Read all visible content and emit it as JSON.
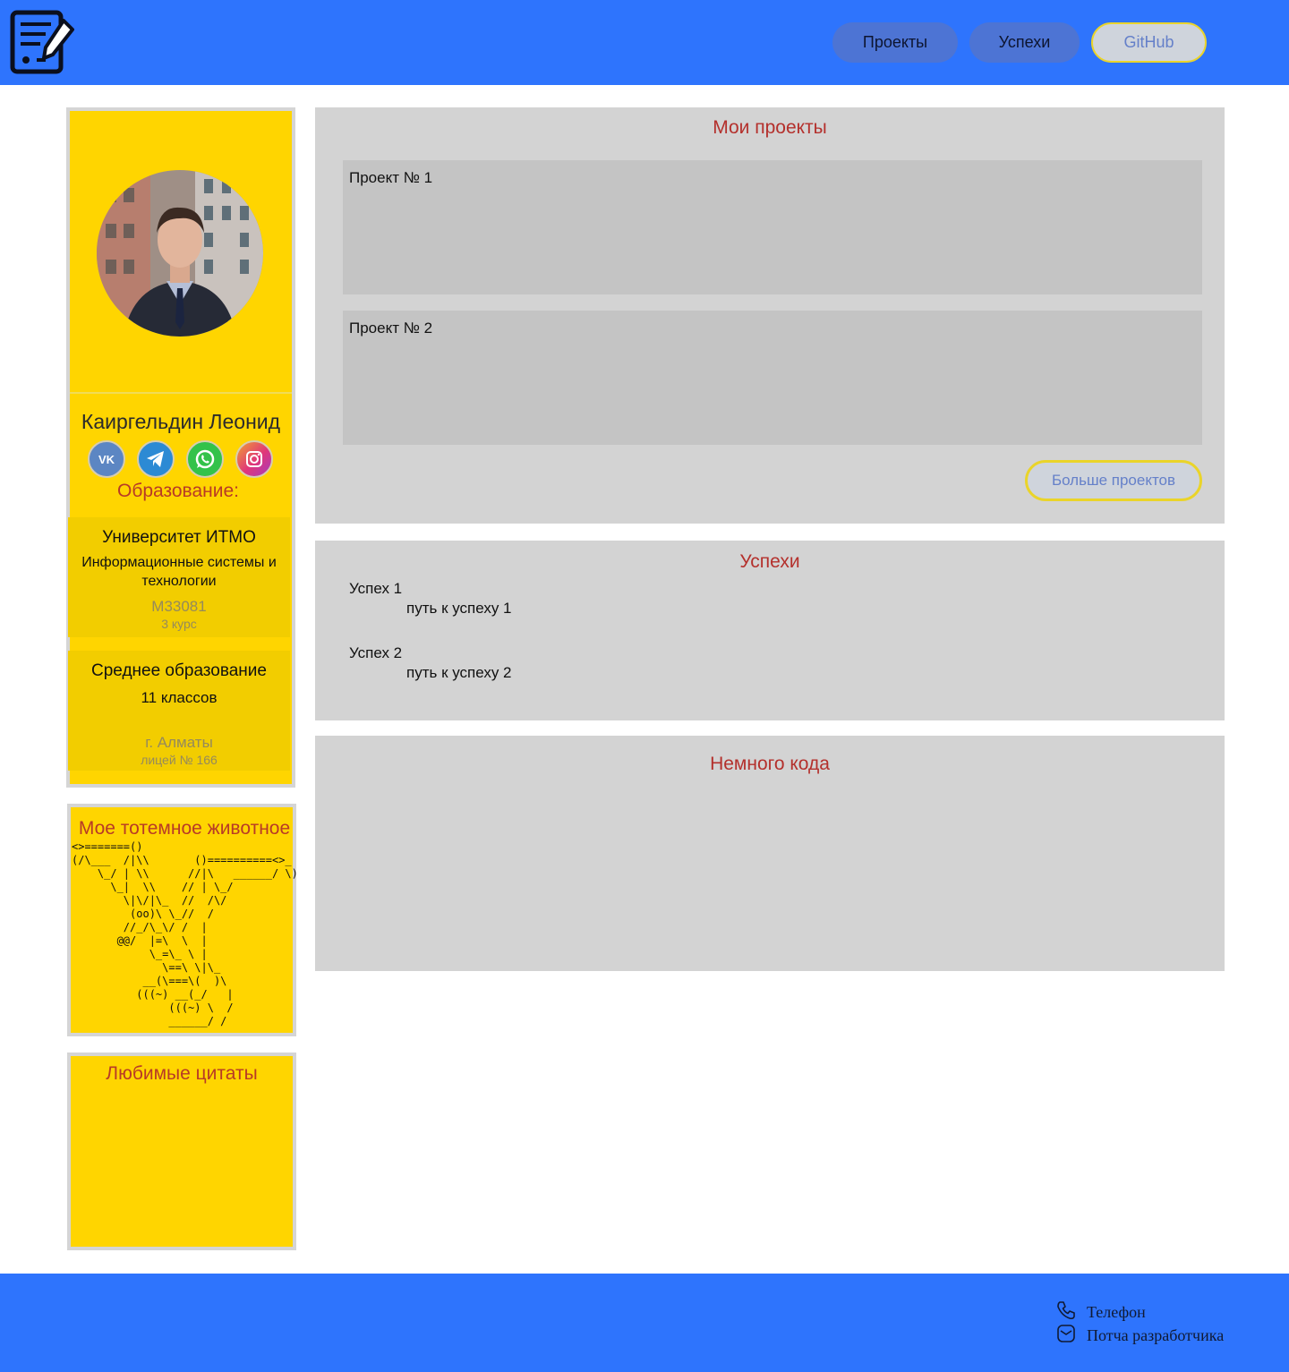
{
  "header": {
    "nav": [
      {
        "label": "Проекты"
      },
      {
        "label": "Успехи"
      },
      {
        "label": "GitHub"
      }
    ]
  },
  "profile": {
    "name": "Каиргельдин Леонид",
    "socials": [
      "vk-icon",
      "telegram-icon",
      "whatsapp-icon",
      "instagram-icon"
    ],
    "education_title": "Образование:",
    "education": [
      {
        "institution": "Университет ИТМО",
        "program": "Информационные системы и технологии",
        "group": "M33081",
        "year": "3 курс"
      },
      {
        "institution": "Среднее образование",
        "program": "11 классов",
        "group": "г. Алматы",
        "year": "лицей № 166"
      }
    ]
  },
  "totem": {
    "title": "Мое тотемное животное",
    "ascii": "<>=======()\n(/\\___  /|\\\\       ()==========<>_\n    \\_/ | \\\\      //|\\   ______/ \\)\n      \\_|  \\\\    // | \\_/\n        \\|\\/|\\_  //  /\\/\n         (oo)\\ \\_//  /\n        //_/\\_\\/ /  |\n       @@/  |=\\  \\  |\n            \\_=\\_ \\ |\n              \\==\\ \\|\\_\n           __(\\===\\(  )\\\n          (((~) __(_/   |\n               (((~) \\  /\n               ______/ /"
  },
  "quotes": {
    "title": "Любимые цитаты"
  },
  "projects": {
    "title": "Мои проекты",
    "items": [
      {
        "label": "Проект № 1"
      },
      {
        "label": "Проект № 2"
      }
    ],
    "more_label": "Больше проектов"
  },
  "successes": {
    "title": "Успехи",
    "items": [
      {
        "name": "Успех 1",
        "path": "путь к успеху 1"
      },
      {
        "name": "Успех 2",
        "path": "путь к успеху 2"
      }
    ]
  },
  "code": {
    "title": "Немного кода"
  },
  "footer": {
    "phone_label": "Телефон",
    "email_label": "Потча разработчика"
  },
  "colors": {
    "header_blue": "#2e74fd",
    "card_yellow": "#ffd500",
    "panel_grey": "#d3d3d3",
    "title_red": "#b4302c"
  }
}
